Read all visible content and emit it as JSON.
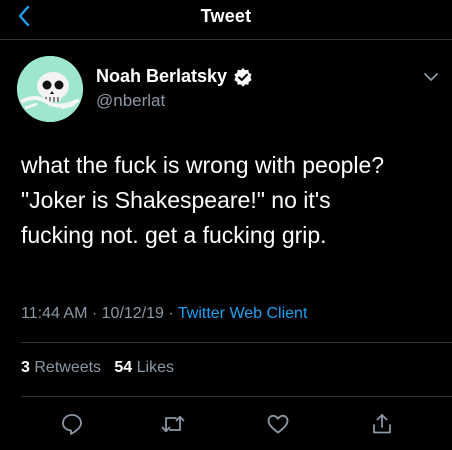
{
  "header": {
    "title": "Tweet",
    "back_icon": "chevron-left-icon"
  },
  "author": {
    "display_name": "Noah Berlatsky",
    "handle": "@nberlat",
    "verified": true
  },
  "tweet": {
    "text_lines": [
      "what the fuck is wrong with people?",
      "\"Joker is Shakespeare!\" no it's",
      "fucking not. get a fucking grip."
    ],
    "time": "11:44 AM",
    "date": "10/12/19",
    "separator": "·",
    "client": "Twitter Web Client"
  },
  "stats": {
    "retweets_count": "3",
    "retweets_label": "Retweets",
    "likes_count": "54",
    "likes_label": "Likes"
  },
  "actions": [
    "reply-icon",
    "retweet-icon",
    "like-icon",
    "share-icon"
  ],
  "colors": {
    "background": "#000000",
    "accent": "#1da1f2",
    "secondary_text": "#8b98a5",
    "divider": "#2f3336",
    "avatar_bg": "#9ee6cf"
  }
}
